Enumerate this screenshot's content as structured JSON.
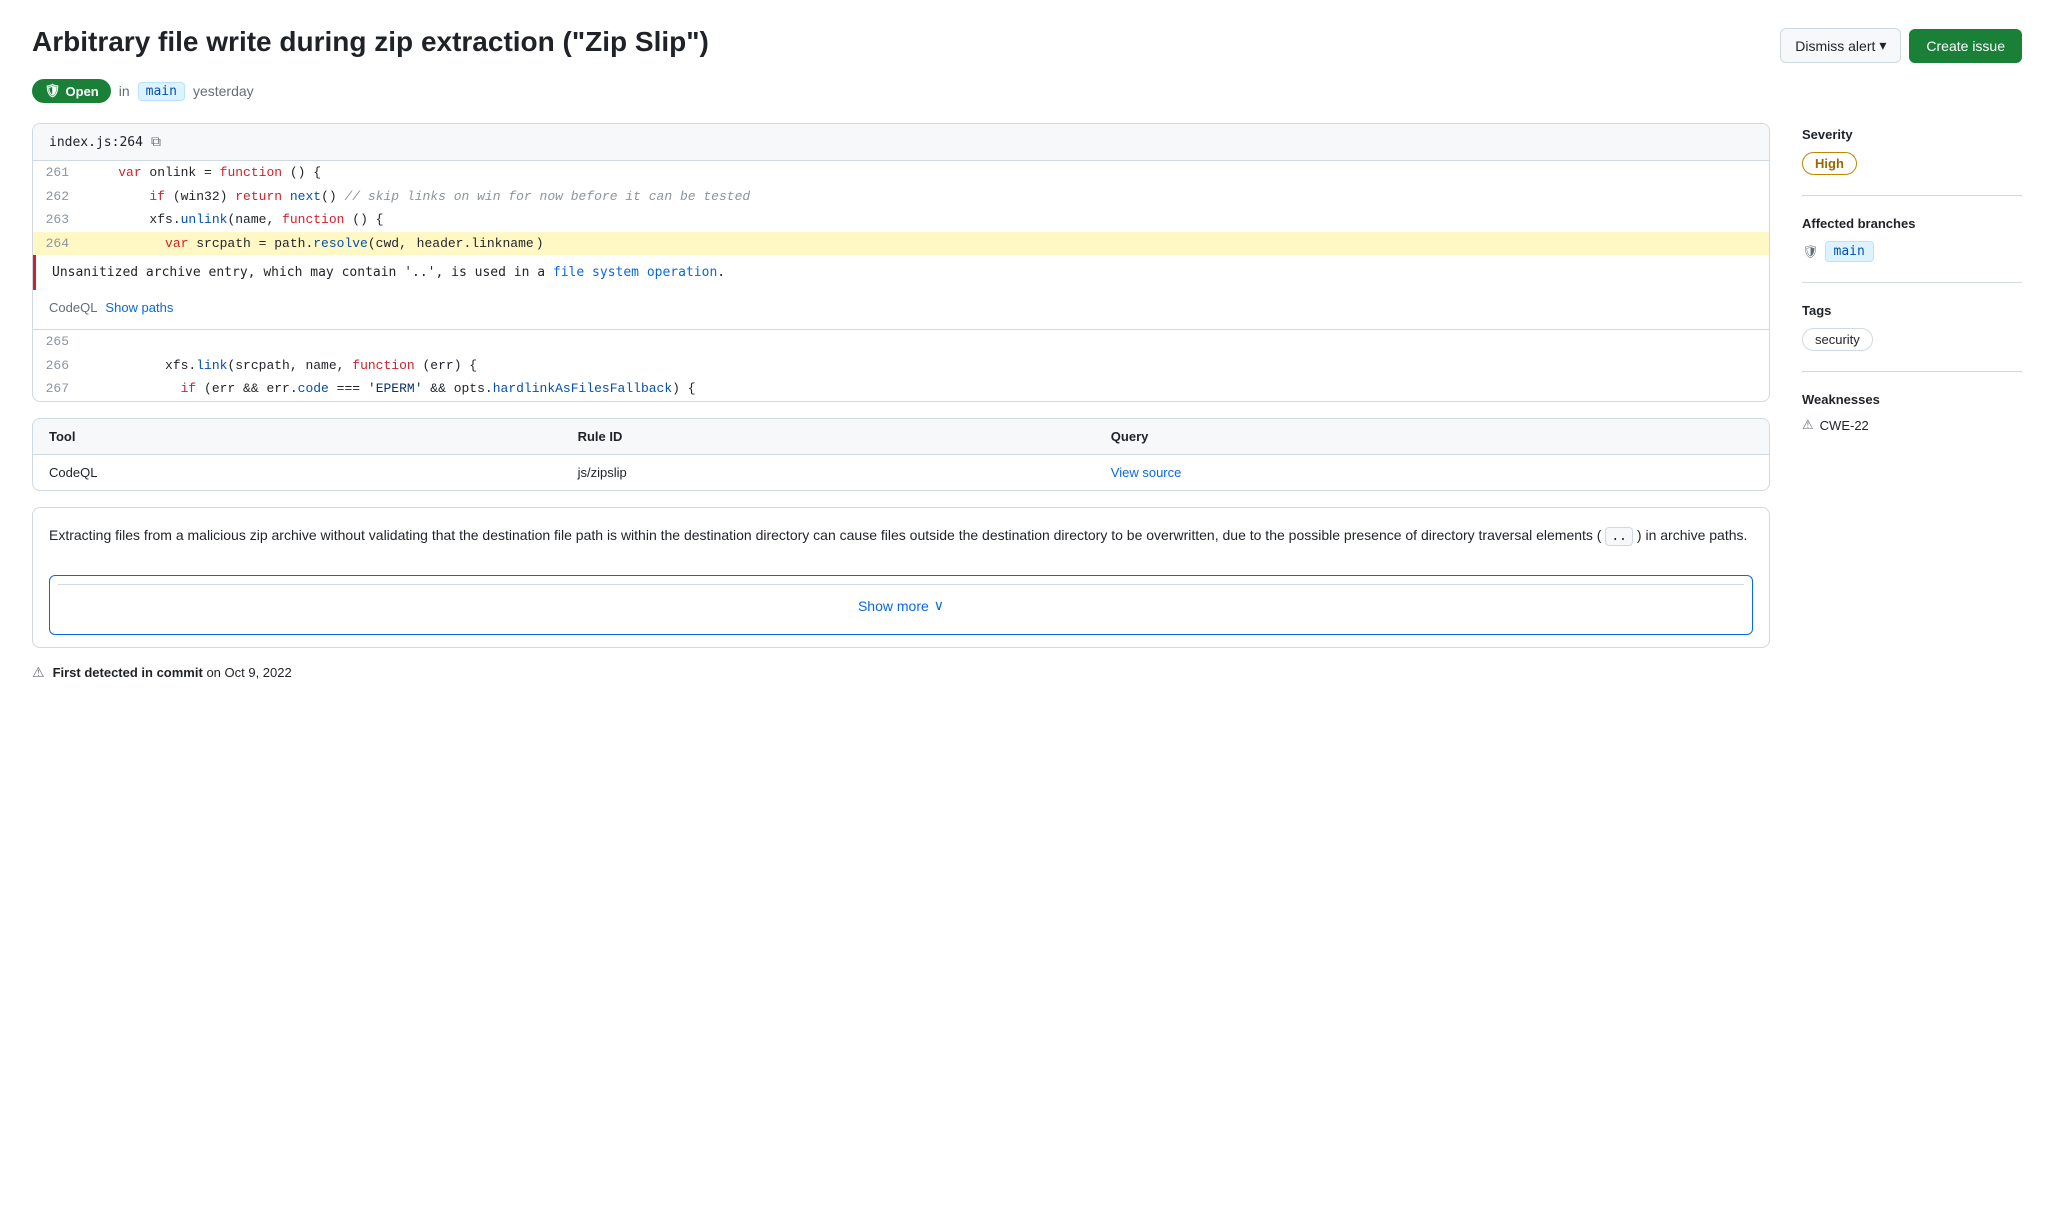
{
  "page": {
    "title": "Arbitrary file write during zip extraction (\"Zip Slip\")",
    "status": "Open",
    "branch": "main",
    "timestamp": "yesterday",
    "dismiss_label": "Dismiss alert",
    "create_label": "Create issue"
  },
  "code": {
    "file": "index.js",
    "line_number": "264",
    "lines": [
      {
        "num": "261",
        "content": "    var onlink = function () {"
      },
      {
        "num": "262",
        "content": "        if (win32) return next() // skip links on win for now before it can be tested"
      },
      {
        "num": "263",
        "content": "        xfs.unlink(name, function () {"
      },
      {
        "num": "264",
        "content": "          var srcpath = path.resolve(cwd, header.linkname)"
      },
      {
        "num": "265",
        "content": ""
      },
      {
        "num": "266",
        "content": "          xfs.link(srcpath, name, function (err) {"
      },
      {
        "num": "267",
        "content": "            if (err && err.code === 'EPERM' && opts.hardlinkAsFilesFallback) {"
      }
    ],
    "alert_message": "Unsanitized archive entry, which may contain '..', is used in a file system operation.",
    "codeql_label": "CodeQL",
    "show_paths_label": "Show paths"
  },
  "tool_table": {
    "headers": [
      "Tool",
      "Rule ID",
      "Query"
    ],
    "rows": [
      {
        "tool": "CodeQL",
        "rule_id": "js/zipslip",
        "query": "View source"
      }
    ]
  },
  "description": {
    "text": "Extracting files from a malicious zip archive without validating that the destination file path is within the destination directory can cause files outside the destination directory to be overwritten, due to the possible presence of directory traversal elements ( .. ) in archive paths.",
    "show_more_label": "Show more"
  },
  "footer": {
    "text": "First detected in commit",
    "date": "on Oct 9, 2022"
  },
  "sidebar": {
    "severity_label": "Severity",
    "severity_value": "High",
    "branches_label": "Affected branches",
    "branch_name": "main",
    "tags_label": "Tags",
    "tag_value": "security",
    "weaknesses_label": "Weaknesses",
    "weakness_value": "CWE-22"
  }
}
